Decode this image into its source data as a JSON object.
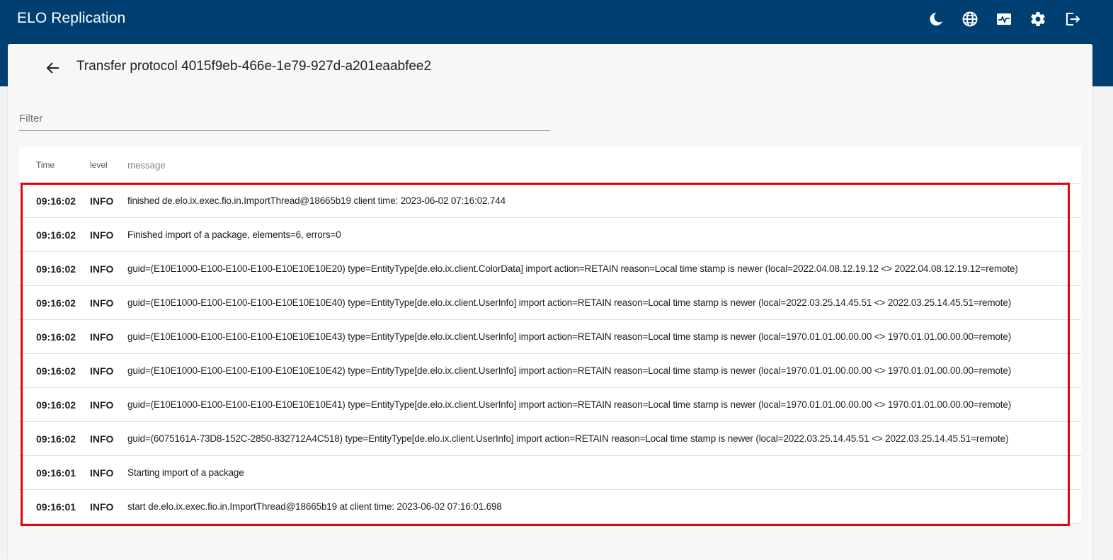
{
  "app": {
    "title": "ELO Replication"
  },
  "topbar_icons": [
    {
      "name": "dark-mode-icon"
    },
    {
      "name": "language-globe-icon"
    },
    {
      "name": "monitor-pulse-icon"
    },
    {
      "name": "settings-gear-icon"
    },
    {
      "name": "logout-icon"
    }
  ],
  "page": {
    "title": "Transfer protocol 4015f9eb-466e-1e79-927d-a201eaabfee2",
    "filter_placeholder": "Filter",
    "filter_value": ""
  },
  "table": {
    "headers": {
      "time": "Time",
      "level": "level",
      "message": "message"
    },
    "rows": [
      {
        "time": "09:16:02",
        "level": "INFO",
        "message": "finished de.elo.ix.exec.fio.in.ImportThread@18665b19 client time: 2023-06-02 07:16:02.744"
      },
      {
        "time": "09:16:02",
        "level": "INFO",
        "message": "Finished import of a package, elements=6, errors=0"
      },
      {
        "time": "09:16:02",
        "level": "INFO",
        "message": "guid=(E10E1000-E100-E100-E100-E10E10E10E20) type=EntityType[de.elo.ix.client.ColorData] import action=RETAIN reason=Local time stamp is newer (local=2022.04.08.12.19.12 <> 2022.04.08.12.19.12=remote)"
      },
      {
        "time": "09:16:02",
        "level": "INFO",
        "message": "guid=(E10E1000-E100-E100-E100-E10E10E10E40) type=EntityType[de.elo.ix.client.UserInfo] import action=RETAIN reason=Local time stamp is newer (local=2022.03.25.14.45.51 <> 2022.03.25.14.45.51=remote)"
      },
      {
        "time": "09:16:02",
        "level": "INFO",
        "message": "guid=(E10E1000-E100-E100-E100-E10E10E10E43) type=EntityType[de.elo.ix.client.UserInfo] import action=RETAIN reason=Local time stamp is newer (local=1970.01.01.00.00.00 <> 1970.01.01.00.00.00=remote)"
      },
      {
        "time": "09:16:02",
        "level": "INFO",
        "message": "guid=(E10E1000-E100-E100-E100-E10E10E10E42) type=EntityType[de.elo.ix.client.UserInfo] import action=RETAIN reason=Local time stamp is newer (local=1970.01.01.00.00.00 <> 1970.01.01.00.00.00=remote)"
      },
      {
        "time": "09:16:02",
        "level": "INFO",
        "message": "guid=(E10E1000-E100-E100-E100-E10E10E10E41) type=EntityType[de.elo.ix.client.UserInfo] import action=RETAIN reason=Local time stamp is newer (local=1970.01.01.00.00.00 <> 1970.01.01.00.00.00=remote)"
      },
      {
        "time": "09:16:02",
        "level": "INFO",
        "message": "guid=(6075161A-73D8-152C-2850-832712A4C518) type=EntityType[de.elo.ix.client.UserInfo] import action=RETAIN reason=Local time stamp is newer (local=2022.03.25.14.45.51 <> 2022.03.25.14.45.51=remote)"
      },
      {
        "time": "09:16:01",
        "level": "INFO",
        "message": "Starting import of a package"
      },
      {
        "time": "09:16:01",
        "level": "INFO",
        "message": "start de.elo.ix.exec.fio.in.ImportThread@18665b19 at client time: 2023-06-02 07:16:01.698"
      }
    ]
  },
  "colors": {
    "header_bg": "#003f72",
    "highlight_border": "#e0060c"
  }
}
